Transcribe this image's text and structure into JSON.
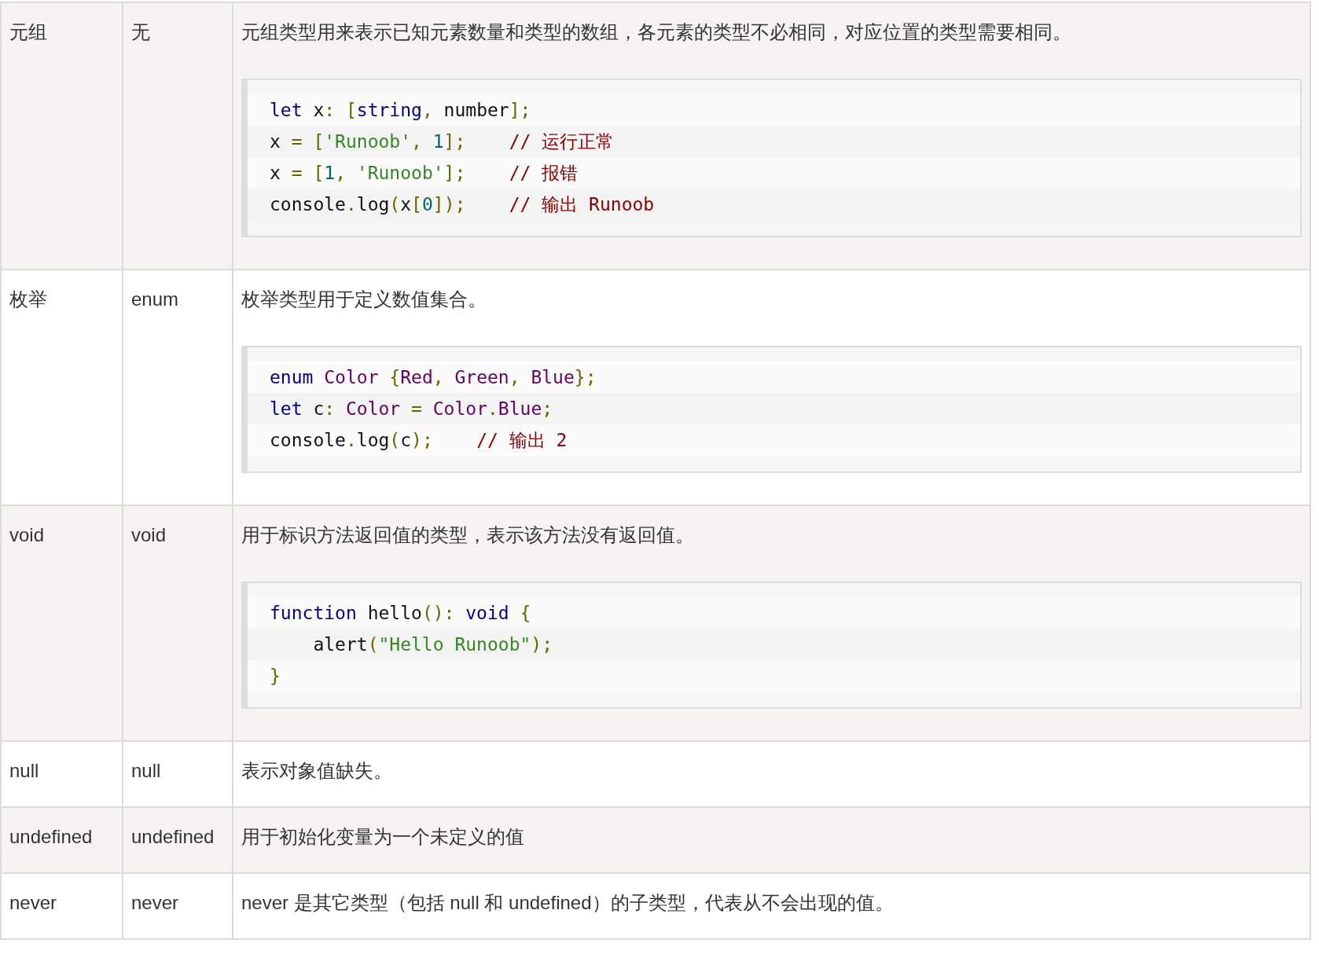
{
  "rows": [
    {
      "type": "元组",
      "keyword": "无",
      "description": "元组类型用来表示已知元素数量和类型的数组，各元素的类型不必相同，对应位置的类型需要相同。",
      "code": [
        [
          {
            "kind": "kw",
            "text": "let"
          },
          {
            "kind": "pln",
            "text": " x"
          },
          {
            "kind": "pun",
            "text": ": "
          },
          {
            "kind": "pun",
            "text": "["
          },
          {
            "kind": "kw",
            "text": "string"
          },
          {
            "kind": "pun",
            "text": ","
          },
          {
            "kind": "pln",
            "text": " number"
          },
          {
            "kind": "pun",
            "text": "];"
          }
        ],
        [
          {
            "kind": "pln",
            "text": "x "
          },
          {
            "kind": "pun",
            "text": "= "
          },
          {
            "kind": "pun",
            "text": "["
          },
          {
            "kind": "str",
            "text": "'Runoob'"
          },
          {
            "kind": "pun",
            "text": ", "
          },
          {
            "kind": "lit",
            "text": "1"
          },
          {
            "kind": "pun",
            "text": "];    "
          },
          {
            "kind": "com",
            "text": "// 运行正常"
          }
        ],
        [
          {
            "kind": "pln",
            "text": "x "
          },
          {
            "kind": "pun",
            "text": "= "
          },
          {
            "kind": "pun",
            "text": "["
          },
          {
            "kind": "lit",
            "text": "1"
          },
          {
            "kind": "pun",
            "text": ", "
          },
          {
            "kind": "str",
            "text": "'Runoob'"
          },
          {
            "kind": "pun",
            "text": "];    "
          },
          {
            "kind": "com",
            "text": "// 报错"
          }
        ],
        [
          {
            "kind": "pln",
            "text": "console"
          },
          {
            "kind": "pun",
            "text": "."
          },
          {
            "kind": "pln",
            "text": "log"
          },
          {
            "kind": "pun",
            "text": "("
          },
          {
            "kind": "pln",
            "text": "x"
          },
          {
            "kind": "pun",
            "text": "["
          },
          {
            "kind": "lit",
            "text": "0"
          },
          {
            "kind": "pun",
            "text": "]);    "
          },
          {
            "kind": "com",
            "text": "// 输出 Runoob"
          }
        ]
      ]
    },
    {
      "type": "枚举",
      "keyword": "enum",
      "description": "枚举类型用于定义数值集合。",
      "code": [
        [
          {
            "kind": "kw",
            "text": "enum "
          },
          {
            "kind": "typ",
            "text": "Color "
          },
          {
            "kind": "pun",
            "text": "{"
          },
          {
            "kind": "typ",
            "text": "Red"
          },
          {
            "kind": "pun",
            "text": ", "
          },
          {
            "kind": "typ",
            "text": "Green"
          },
          {
            "kind": "pun",
            "text": ", "
          },
          {
            "kind": "typ",
            "text": "Blue"
          },
          {
            "kind": "pun",
            "text": "};"
          }
        ],
        [
          {
            "kind": "kw",
            "text": "let"
          },
          {
            "kind": "pln",
            "text": " c"
          },
          {
            "kind": "pun",
            "text": ": "
          },
          {
            "kind": "typ",
            "text": "Color "
          },
          {
            "kind": "pun",
            "text": "= "
          },
          {
            "kind": "typ",
            "text": "Color"
          },
          {
            "kind": "pun",
            "text": "."
          },
          {
            "kind": "typ",
            "text": "Blue"
          },
          {
            "kind": "pun",
            "text": ";"
          }
        ],
        [
          {
            "kind": "pln",
            "text": "console"
          },
          {
            "kind": "pun",
            "text": "."
          },
          {
            "kind": "pln",
            "text": "log"
          },
          {
            "kind": "pun",
            "text": "("
          },
          {
            "kind": "pln",
            "text": "c"
          },
          {
            "kind": "pun",
            "text": ");    "
          },
          {
            "kind": "com",
            "text": "// 输出 2"
          }
        ]
      ]
    },
    {
      "type": "void",
      "keyword": "void",
      "description": "用于标识方法返回值的类型，表示该方法没有返回值。",
      "code": [
        [
          {
            "kind": "kw",
            "text": "function"
          },
          {
            "kind": "pln",
            "text": " hello"
          },
          {
            "kind": "pun",
            "text": "(): "
          },
          {
            "kind": "kw",
            "text": "void "
          },
          {
            "kind": "pun",
            "text": "{"
          }
        ],
        [
          {
            "kind": "pln",
            "text": "    alert"
          },
          {
            "kind": "pun",
            "text": "("
          },
          {
            "kind": "str",
            "text": "\"Hello Runoob\""
          },
          {
            "kind": "pun",
            "text": ");"
          }
        ],
        [
          {
            "kind": "pun",
            "text": "}"
          }
        ]
      ]
    },
    {
      "type": "null",
      "keyword": "null",
      "description": "表示对象值缺失。"
    },
    {
      "type": "undefined",
      "keyword": "undefined",
      "description": "用于初始化变量为一个未定义的值"
    },
    {
      "type": "never",
      "keyword": "never",
      "description": "never 是其它类型（包括 null 和 undefined）的子类型，代表从不会出现的值。"
    }
  ]
}
